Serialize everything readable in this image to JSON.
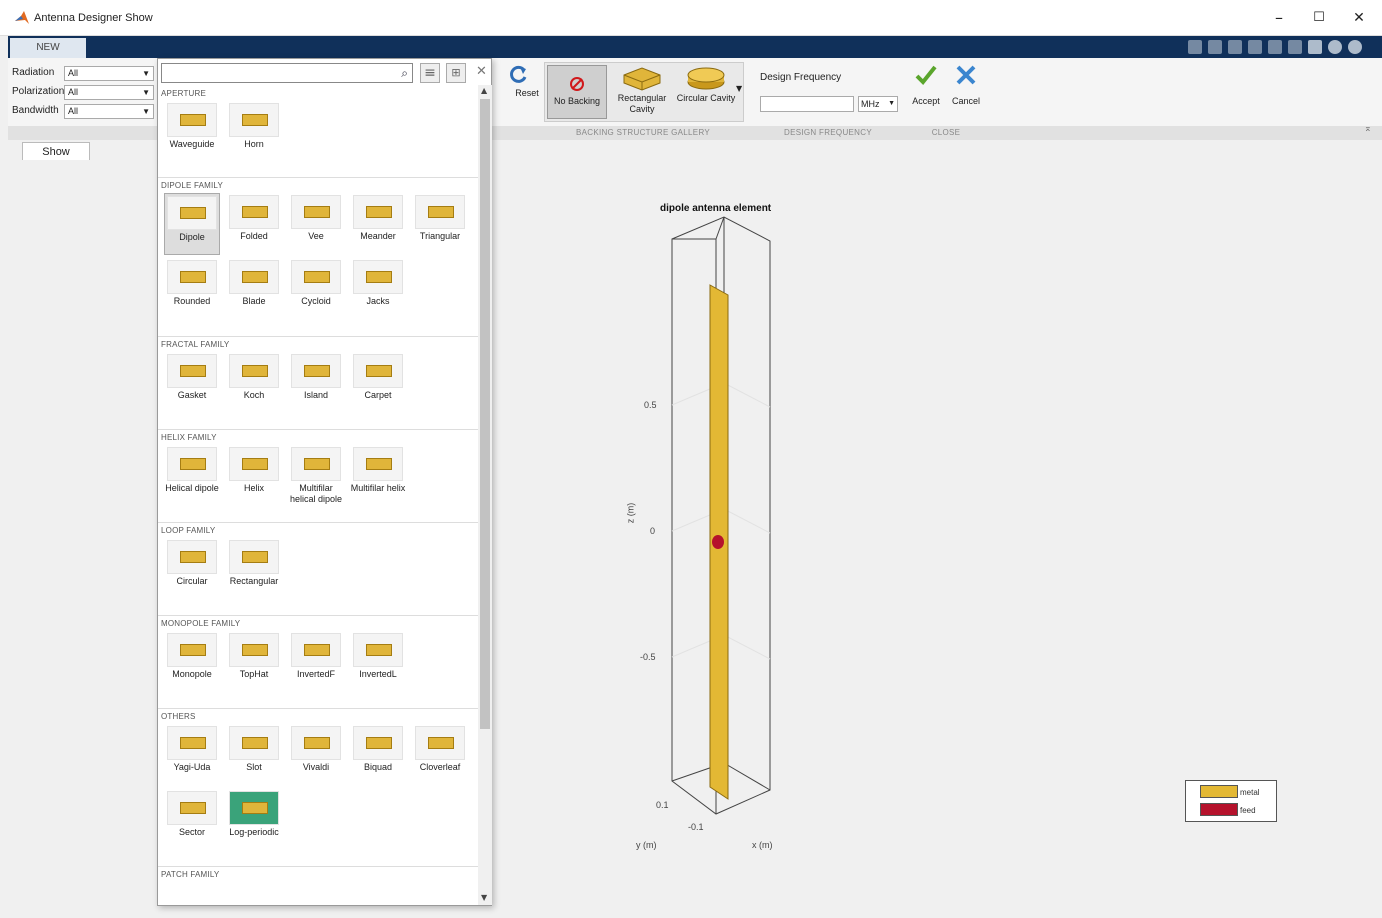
{
  "window": {
    "title": "Antenna Designer  Show",
    "minimize_glyph": "–",
    "maximize_glyph": "☐",
    "close_glyph": "✕"
  },
  "tabstrip": {
    "new_tab": "NEW"
  },
  "filters": [
    {
      "label": "Radiation",
      "value": "All"
    },
    {
      "label": "Polarization",
      "value": "All"
    },
    {
      "label": "Bandwidth",
      "value": "All"
    }
  ],
  "toolstrip": {
    "reset_label": "Reset",
    "backing": [
      {
        "label": "No Backing",
        "icon": "no-backing-icon"
      },
      {
        "label": "Rectangular Cavity",
        "icon": "rectangular-cavity-icon"
      },
      {
        "label": "Circular Cavity",
        "icon": "circular-cavity-icon"
      }
    ],
    "design_frequency_label": "Design Frequency",
    "frequency_value": "",
    "frequency_unit": "MHz",
    "accept_label": "Accept",
    "cancel_label": "Cancel",
    "sections": [
      "BACKING STRUCTURE GALLERY",
      "DESIGN FREQUENCY",
      "CLOSE"
    ]
  },
  "document_tab": "Show",
  "gallery": {
    "search_value": "",
    "sections": [
      {
        "title": "APERTURE",
        "items": [
          "Waveguide",
          "Horn"
        ]
      },
      {
        "title": "DIPOLE FAMILY",
        "items": [
          "Dipole",
          "Folded",
          "Vee",
          "Meander",
          "Triangular",
          "Rounded",
          "Blade",
          "Cycloid",
          "Jacks"
        ]
      },
      {
        "title": "FRACTAL FAMILY",
        "items": [
          "Gasket",
          "Koch",
          "Island",
          "Carpet"
        ]
      },
      {
        "title": "HELIX FAMILY",
        "items": [
          "Helical dipole",
          "Helix",
          "Multifilar helical dipole",
          "Multifilar helix"
        ]
      },
      {
        "title": "LOOP FAMILY",
        "items": [
          "Circular",
          "Rectangular"
        ]
      },
      {
        "title": "MONOPOLE FAMILY",
        "items": [
          "Monopole",
          "TopHat",
          "InvertedF",
          "InvertedL"
        ]
      },
      {
        "title": "OTHERS",
        "items": [
          "Yagi-Uda",
          "Slot",
          "Vivaldi",
          "Biquad",
          "Cloverleaf",
          "Sector",
          "Log-periodic"
        ]
      },
      {
        "title": "PATCH FAMILY",
        "items": []
      }
    ],
    "selected": "Dipole"
  },
  "plot": {
    "title": "dipole antenna element",
    "zlabel": "z (m)",
    "ylabel": "y (m)",
    "xlabel": "x (m)",
    "zticks": [
      "0.5",
      "0",
      "-0.5"
    ],
    "yticks": [
      "0.1"
    ],
    "xticks": [
      "-0.1"
    ],
    "legend": [
      {
        "label": "metal",
        "color": "#e3b834"
      },
      {
        "label": "feed",
        "color": "#b5122c"
      }
    ]
  },
  "colors": {
    "accent": "#10305a",
    "metal": "#e3b834",
    "feed": "#b5122c"
  }
}
